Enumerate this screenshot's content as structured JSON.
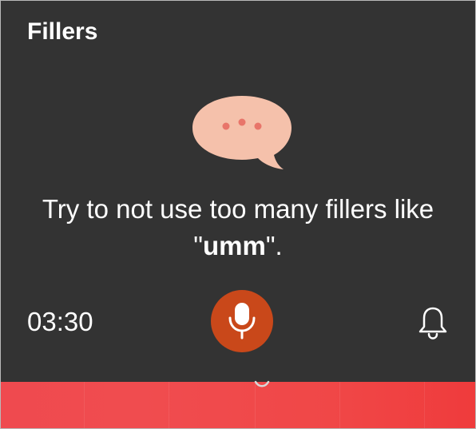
{
  "header": {
    "title": "Fillers"
  },
  "icon": {
    "name": "speech-bubble-icon",
    "bubble_color": "#f5c1ab",
    "dot_color": "#e8756a"
  },
  "message": {
    "line1": "Try to not use too many fillers like",
    "quote_open": "\"",
    "filler_word": "umm",
    "quote_close": "\"."
  },
  "footer": {
    "timer": "03:30",
    "mic_icon": "microphone-icon",
    "mic_color": "#c9481a",
    "bell_icon": "bell-icon"
  },
  "colors": {
    "panel_background": "#333333",
    "accent_bar": "#f04a4d"
  }
}
